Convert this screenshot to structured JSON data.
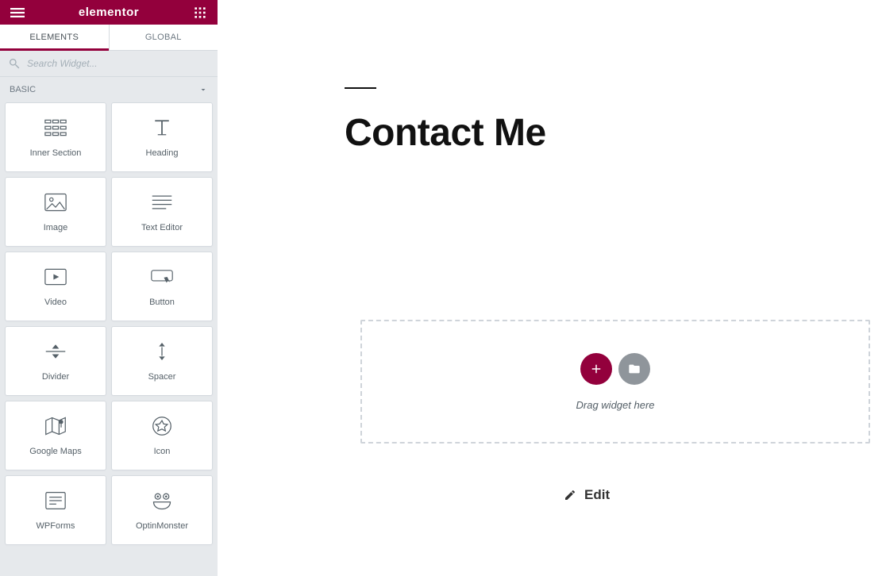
{
  "header": {
    "brand": "elementor"
  },
  "tabs": {
    "elements": "ELEMENTS",
    "global": "GLOBAL"
  },
  "search": {
    "placeholder": "Search Widget..."
  },
  "category": {
    "basic": "BASIC"
  },
  "widgets": [
    {
      "id": "inner-section",
      "label": "Inner Section"
    },
    {
      "id": "heading",
      "label": "Heading"
    },
    {
      "id": "image",
      "label": "Image"
    },
    {
      "id": "text-editor",
      "label": "Text Editor"
    },
    {
      "id": "video",
      "label": "Video"
    },
    {
      "id": "button",
      "label": "Button"
    },
    {
      "id": "divider",
      "label": "Divider"
    },
    {
      "id": "spacer",
      "label": "Spacer"
    },
    {
      "id": "google-maps",
      "label": "Google Maps"
    },
    {
      "id": "icon",
      "label": "Icon"
    },
    {
      "id": "wpforms",
      "label": "WPForms"
    },
    {
      "id": "optinmonster",
      "label": "OptinMonster"
    }
  ],
  "page": {
    "title": "Contact Me",
    "dropzone_hint": "Drag widget here",
    "edit_label": "Edit"
  }
}
